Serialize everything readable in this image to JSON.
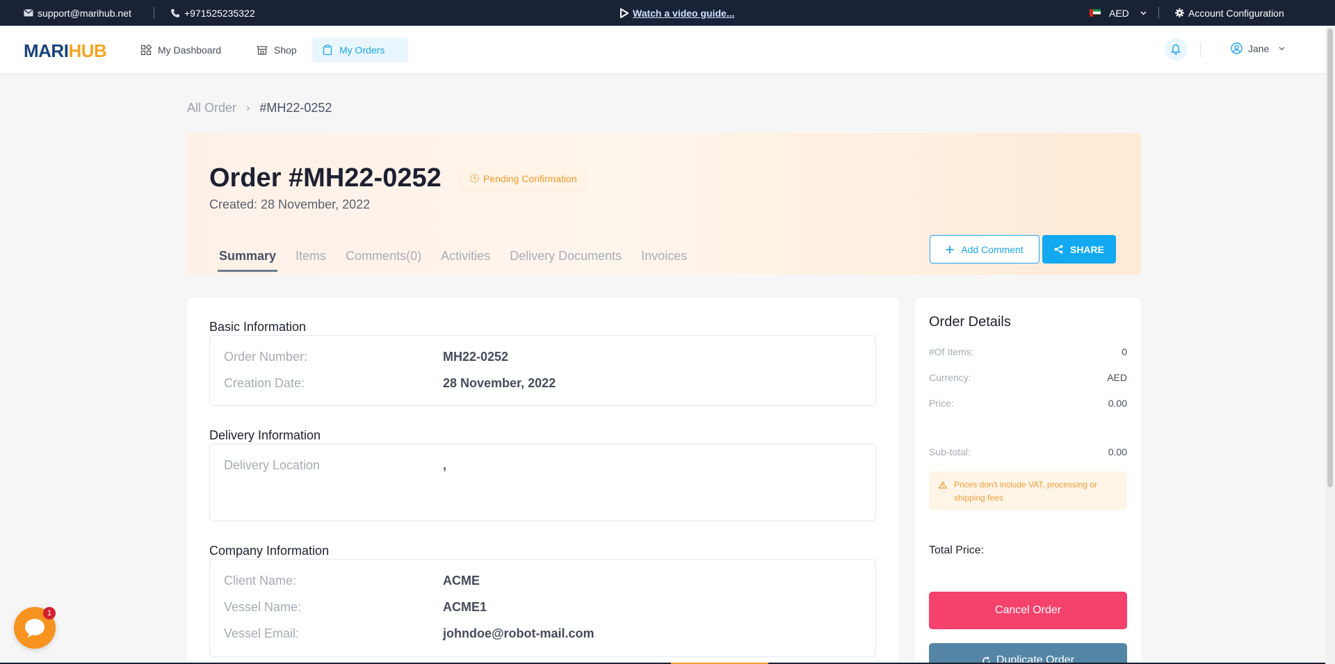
{
  "topbar": {
    "email": "support@marihub.net",
    "phone": "+971525235322",
    "video_link": "Watch a video guide...",
    "currency": "AED",
    "account_config": "Account Configuration"
  },
  "nav": {
    "logo_part1": "MARI",
    "logo_part2": "HUB",
    "items": [
      {
        "label": "My Dashboard"
      },
      {
        "label": "Shop"
      },
      {
        "label": "My Orders"
      }
    ],
    "user_name": "Jane"
  },
  "breadcrumb": {
    "parent": "All Order",
    "current": "#MH22-0252"
  },
  "order": {
    "title": "Order #MH22-0252",
    "status": "Pending Confirmation",
    "created": "Created: 28 November, 2022",
    "tabs": [
      "Summary",
      "Items",
      "Comments(0)",
      "Activities",
      "Delivery Documents",
      "Invoices"
    ],
    "add_comment": "Add Comment",
    "share": "SHARE"
  },
  "basic_info": {
    "title": "Basic Information",
    "rows": [
      {
        "label": "Order Number:",
        "value": "MH22-0252"
      },
      {
        "label": "Creation Date:",
        "value": "28 November, 2022"
      }
    ]
  },
  "delivery_info": {
    "title": "Delivery Information",
    "rows": [
      {
        "label": "Delivery Location",
        "value": ","
      }
    ]
  },
  "company_info": {
    "title": "Company Information",
    "rows": [
      {
        "label": "Client Name:",
        "value": "ACME"
      },
      {
        "label": "Vessel Name:",
        "value": "ACME1"
      },
      {
        "label": "Vessel Email:",
        "value": "johndoe@robot-mail.com"
      }
    ]
  },
  "order_details": {
    "title": "Order Details",
    "rows": [
      {
        "label": "#Of Items:",
        "value": "0"
      },
      {
        "label": "Currency:",
        "value": "AED"
      },
      {
        "label": "Price:",
        "value": "0.00"
      },
      {
        "label": "Sub-total:",
        "value": "0.00"
      }
    ],
    "vat_note": "Prices don't include VAT, processing or shipping fees",
    "total_label": "Total Price:",
    "cancel_button": "Cancel Order",
    "duplicate_button": "Duplicate Order"
  },
  "chat": {
    "unread": "1"
  }
}
